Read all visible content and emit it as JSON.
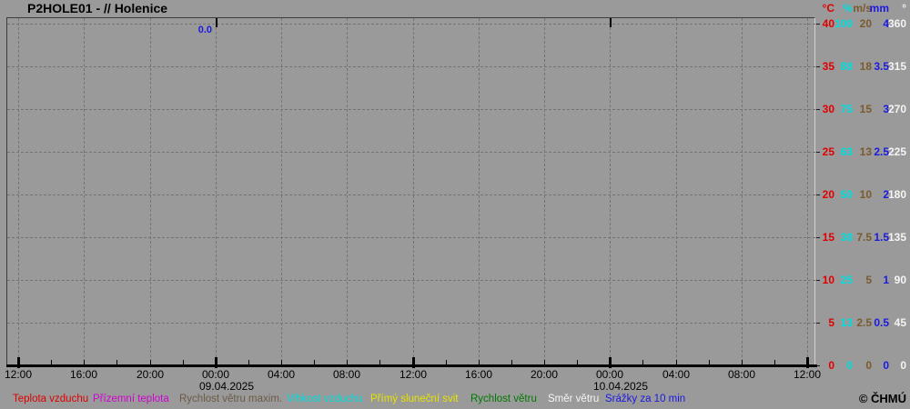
{
  "title": "P2HOLE01 - // Holenice",
  "copyright": "© ČHMÚ",
  "annotation": {
    "value": "0.0",
    "color": "#1a1ae0"
  },
  "colors": {
    "background": "#9a9a9a",
    "grid": "#747474",
    "axis": "#000000",
    "temperature": "#e00000",
    "ground_temperature": "#d200d2",
    "wind_max": "#6a5c46",
    "humidity": "#00dede",
    "sunshine": "#e4e400",
    "wind": "#007a00",
    "wind_direction": "#f5f5f5",
    "precipitation": "#1a1ae0",
    "wind_max_scale": "#7b5a2e"
  },
  "axes": {
    "right": {
      "units": [
        {
          "label": "°C",
          "color": "#e00000"
        },
        {
          "label": "%",
          "color": "#00dede"
        },
        {
          "label": "m/s",
          "color": "#7b5a2e"
        },
        {
          "label": "mm",
          "color": "#1a1ae0"
        },
        {
          "label": "°",
          "color": "#f5f5f5"
        }
      ],
      "rows": [
        [
          "40",
          "100",
          "20",
          "4",
          "360"
        ],
        [
          "35",
          "88",
          "18",
          "3.5",
          "315"
        ],
        [
          "30",
          "75",
          "15",
          "3",
          "270"
        ],
        [
          "25",
          "63",
          "13",
          "2.5",
          "225"
        ],
        [
          "20",
          "50",
          "10",
          "2",
          "180"
        ],
        [
          "15",
          "38",
          "7.5",
          "1.5",
          "135"
        ],
        [
          "10",
          "25",
          "5",
          "1",
          "90"
        ],
        [
          "5",
          "13",
          "2.5",
          "0.5",
          "45"
        ],
        [
          "0",
          "0",
          "0",
          "0",
          "0"
        ]
      ]
    },
    "x": {
      "time_labels": [
        "12:00",
        "16:00",
        "20:00",
        "00:00",
        "04:00",
        "08:00",
        "12:00",
        "16:00",
        "20:00",
        "00:00",
        "04:00",
        "08:00",
        "12:00"
      ],
      "date_labels": [
        {
          "text": "09.04.2025",
          "tick_index": 3
        },
        {
          "text": "10.04.2025",
          "tick_index": 9
        }
      ]
    }
  },
  "legend": [
    {
      "label": "Teplota vzduchu",
      "color": "#e00000"
    },
    {
      "label": "Přízemní teplota",
      "color": "#d200d2"
    },
    {
      "label": "Rychlost větru maxim.",
      "color": "#6a5c46"
    },
    {
      "label": "Vlhkost vzduchu",
      "color": "#00dede"
    },
    {
      "label": "Přímý sluneční svit",
      "color": "#e4e400"
    },
    {
      "label": "Rychlost větru",
      "color": "#007a00"
    },
    {
      "label": "Směr větru",
      "color": "#f5f5f5"
    },
    {
      "label": "Srážky za 10 min",
      "color": "#1a1ae0"
    }
  ],
  "chart_data": {
    "type": "line",
    "title": "P2HOLE01 - // Holenice",
    "grid": true,
    "note": "Plot area is empty - no data series are drawn for this period; only a blue 0.0 precipitation annotation appears near 09.04.2025 00:00.",
    "x": {
      "span_hours": 48,
      "tick_labels": [
        "12:00",
        "16:00",
        "20:00",
        "00:00",
        "04:00",
        "08:00",
        "12:00",
        "16:00",
        "20:00",
        "00:00",
        "04:00",
        "08:00",
        "12:00"
      ],
      "minor_tick_interval_hours": 2,
      "gridline_interval_hours": 4,
      "dates": [
        "09.04.2025",
        "10.04.2025"
      ]
    },
    "y_axes": [
      {
        "unit": "°C",
        "ticks": [
          40,
          35,
          30,
          25,
          20,
          15,
          10,
          5,
          0
        ],
        "color": "#e00000"
      },
      {
        "unit": "%",
        "ticks": [
          100,
          88,
          75,
          63,
          50,
          38,
          25,
          13,
          0
        ],
        "color": "#00dede"
      },
      {
        "unit": "m/s",
        "ticks": [
          20,
          18,
          15,
          13,
          10,
          7.5,
          5,
          2.5,
          0
        ],
        "color": "#7b5a2e"
      },
      {
        "unit": "mm",
        "ticks": [
          4,
          3.5,
          3,
          2.5,
          2,
          1.5,
          1,
          0.5,
          0
        ],
        "color": "#1a1ae0"
      },
      {
        "unit": "°",
        "ticks": [
          360,
          315,
          270,
          225,
          180,
          135,
          90,
          45,
          0
        ],
        "color": "#f5f5f5"
      }
    ],
    "series": [
      {
        "name": "Teplota vzduchu",
        "unit": "°C",
        "color": "#e00000",
        "values": []
      },
      {
        "name": "Přízemní teplota",
        "unit": "°C",
        "color": "#d200d2",
        "values": []
      },
      {
        "name": "Rychlost větru maxim.",
        "unit": "m/s",
        "color": "#6a5c46",
        "values": []
      },
      {
        "name": "Vlhkost vzduchu",
        "unit": "%",
        "color": "#00dede",
        "values": []
      },
      {
        "name": "Přímý sluneční svit",
        "unit": "",
        "color": "#e4e400",
        "values": []
      },
      {
        "name": "Rychlost větru",
        "unit": "m/s",
        "color": "#007a00",
        "values": []
      },
      {
        "name": "Směr větru",
        "unit": "°",
        "color": "#f5f5f5",
        "values": []
      },
      {
        "name": "Srážky za 10 min",
        "unit": "mm",
        "color": "#1a1ae0",
        "values": []
      }
    ],
    "annotations": [
      {
        "text": "0.0",
        "color": "#1a1ae0",
        "position": "top of plot, just left of 09.04.2025 00:00"
      }
    ],
    "legend_position": "bottom"
  }
}
